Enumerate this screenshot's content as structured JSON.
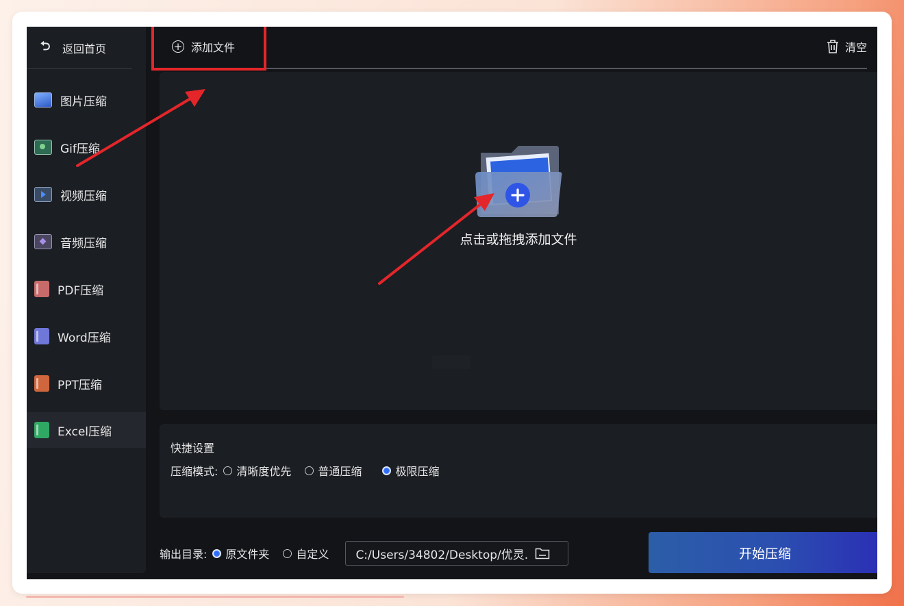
{
  "sidebar": {
    "back_label": "返回首页",
    "items": [
      {
        "label": "图片压缩",
        "icon": "image-icon"
      },
      {
        "label": "Gif压缩",
        "icon": "gif-icon"
      },
      {
        "label": "视频压缩",
        "icon": "video-icon"
      },
      {
        "label": "音频压缩",
        "icon": "audio-icon"
      },
      {
        "label": "PDF压缩",
        "icon": "pdf-icon"
      },
      {
        "label": "Word压缩",
        "icon": "word-icon"
      },
      {
        "label": "PPT压缩",
        "icon": "ppt-icon"
      },
      {
        "label": "Excel压缩",
        "icon": "excel-icon",
        "active": true
      }
    ]
  },
  "toolbar": {
    "add_file_label": "添加文件",
    "clear_label": "清空"
  },
  "dropzone": {
    "hint": "点击或拖拽添加文件"
  },
  "settings": {
    "title": "快捷设置",
    "mode_label": "压缩模式:",
    "modes": [
      {
        "label": "清晰度优先",
        "selected": false
      },
      {
        "label": "普通压缩",
        "selected": false
      },
      {
        "label": "极限压缩",
        "selected": true
      }
    ]
  },
  "output": {
    "label": "输出目录:",
    "options": [
      {
        "label": "原文件夹",
        "selected": true
      },
      {
        "label": "自定义",
        "selected": false
      }
    ],
    "path": "C:/Users/34802/Desktop/优灵."
  },
  "start_button_label": "开始压缩",
  "colors": {
    "background": "#121418",
    "panel": "#1b1e23",
    "accent": "#2f6df4",
    "annotation": "#e4262a"
  }
}
